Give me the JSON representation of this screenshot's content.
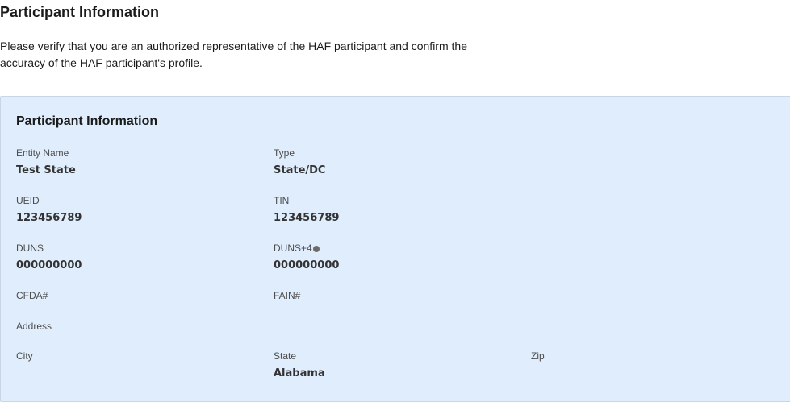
{
  "page": {
    "title": "Participant Information",
    "intro": "Please verify that you are an authorized representative of the HAF participant and confirm the accuracy of the HAF participant's profile."
  },
  "card": {
    "title": "Participant Information",
    "fields": {
      "entity_name": {
        "label": "Entity Name",
        "value": "Test State"
      },
      "type": {
        "label": "Type",
        "value": "State/DC"
      },
      "ueid": {
        "label": "UEID",
        "value": "123456789"
      },
      "tin": {
        "label": "TIN",
        "value": "123456789"
      },
      "duns": {
        "label": "DUNS",
        "value": "000000000"
      },
      "duns4": {
        "label": "DUNS+4",
        "value": "000000000",
        "icon": "info-icon"
      },
      "cfda": {
        "label": "CFDA#",
        "value": ""
      },
      "fain": {
        "label": "FAIN#",
        "value": ""
      },
      "address": {
        "label": "Address",
        "value": ""
      },
      "city": {
        "label": "City",
        "value": ""
      },
      "state": {
        "label": "State",
        "value": "Alabama"
      },
      "zip": {
        "label": "Zip",
        "value": ""
      }
    }
  }
}
